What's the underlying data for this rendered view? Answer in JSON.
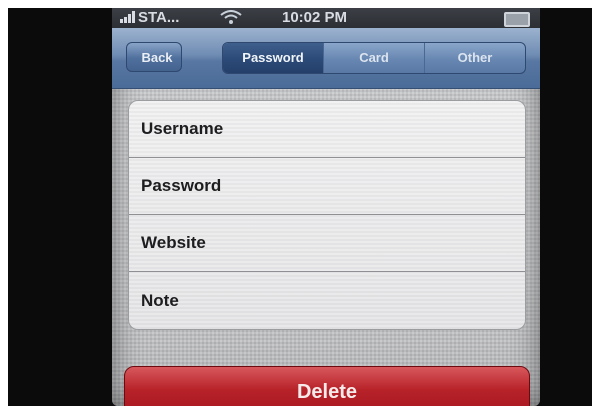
{
  "status_bar": {
    "carrier": "STA...",
    "time": "10:02 PM"
  },
  "navbar": {
    "back_label": "Back",
    "tabs": [
      {
        "label": "Password",
        "selected": true
      },
      {
        "label": "Card",
        "selected": false
      },
      {
        "label": "Other",
        "selected": false
      }
    ]
  },
  "form": {
    "fields": [
      {
        "label": "Username"
      },
      {
        "label": "Password"
      },
      {
        "label": "Website"
      },
      {
        "label": "Note"
      }
    ]
  },
  "actions": {
    "delete_label": "Delete",
    "delete_color": "#b8232a"
  },
  "icons": {
    "signal": "signal-strength-icon",
    "wifi": "wifi-icon",
    "battery": "battery-icon"
  }
}
